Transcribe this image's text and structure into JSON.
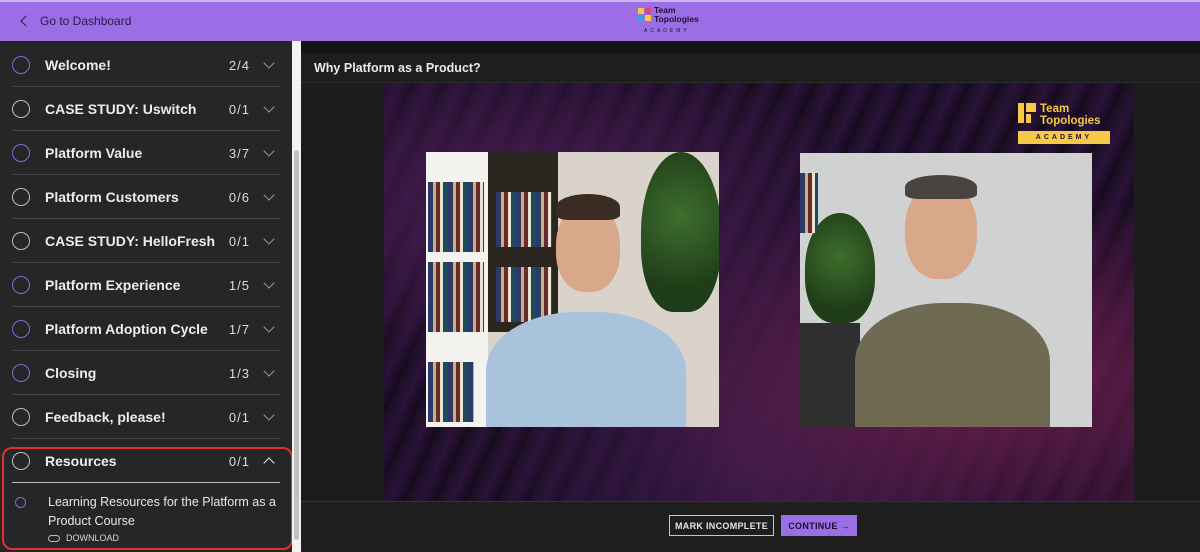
{
  "header": {
    "back_label": "Go to Dashboard",
    "logo_line1": "Team",
    "logo_line2": "Topologies",
    "logo_sub": "ACADEMY",
    "accent_color": "#9b6ee6"
  },
  "sidebar": {
    "sections": [
      {
        "title": "Welcome!",
        "count": "2/4",
        "status": "in-progress"
      },
      {
        "title": "CASE STUDY: Uswitch",
        "count": "0/1",
        "status": "not-started"
      },
      {
        "title": "Platform Value",
        "count": "3/7",
        "status": "in-progress"
      },
      {
        "title": "Platform Customers",
        "count": "0/6",
        "status": "not-started"
      },
      {
        "title": "CASE STUDY: HelloFresh",
        "count": "0/1",
        "status": "not-started"
      },
      {
        "title": "Platform Experience",
        "count": "1/5",
        "status": "in-progress"
      },
      {
        "title": "Platform Adoption Cycle",
        "count": "1/7",
        "status": "in-progress"
      },
      {
        "title": "Closing",
        "count": "1/3",
        "status": "in-progress"
      },
      {
        "title": "Feedback, please!",
        "count": "0/1",
        "status": "not-started"
      },
      {
        "title": "Resources",
        "count": "0/1",
        "status": "not-started",
        "expanded": true
      }
    ],
    "open_lesson": {
      "title": "Learning Resources for the Platform as a Product Course",
      "download_label": "DOWNLOAD"
    }
  },
  "main": {
    "lesson_title": "Why Platform as a Product?",
    "video_logo_line1": "Team",
    "video_logo_line2": "Topologies",
    "video_logo_sub": "ACADEMY",
    "video_logo_color": "#f7c948",
    "mark_incomplete_label": "MARK INCOMPLETE",
    "continue_label": "CONTINUE →"
  }
}
